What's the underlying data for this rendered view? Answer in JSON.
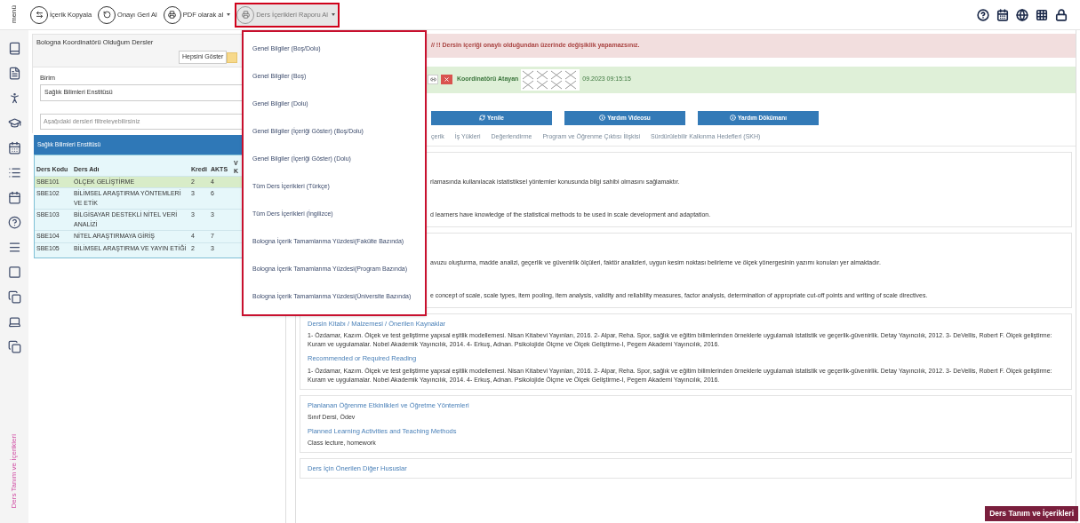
{
  "toolbar": {
    "menu_label": "menü",
    "buttons": [
      {
        "label": "İçerik Kopyala",
        "dropdown": false,
        "selected": false
      },
      {
        "label": "Onayı Geri Al",
        "dropdown": false,
        "selected": false
      },
      {
        "label": "PDF olarak al",
        "dropdown": true,
        "selected": false
      },
      {
        "label": "Ders İçerikleri Raporu Al",
        "dropdown": true,
        "selected": true
      }
    ]
  },
  "report_menu": {
    "items": [
      "Genel Bilgiler (Boş/Dolu)",
      "Genel Bilgiler (Boş)",
      "Genel Bilgiler (Dolu)",
      "Genel Bilgiler (İçeriği Göster) (Boş/Dolu)",
      "Genel Bilgiler (İçeriği Göster) (Dolu)",
      "Tüm Ders İçerikleri (Türkçe)",
      "Tüm Ders İçerikleri (İngilizce)",
      "Bologna İçerik Tamamlanma Yüzdesi(Fakülte Bazında)",
      "Bologna İçerik Tamamlanma Yüzdesi(Program Bazında)",
      "Bologna İçerik Tamamlanma Yüzdesi(Üniversite Bazında)"
    ]
  },
  "sidebar": {
    "vertical_label": "Ders Tanım ve İçerikleri"
  },
  "course_panel": {
    "title": "Bologna Koordinatörü Olduğum Dersler",
    "show_all_button": "Hepsini Göster",
    "unit_label": "Birim",
    "unit_value": "Sağlık Bilimleri Enstitüsü",
    "filter_placeholder": "Aşağıdaki dersleri filtreleyebilirsiniz",
    "group_title": "Sağlık Bilimleri Enstitüsü",
    "columns": [
      "Ders Kodu",
      "Ders Adı",
      "Kredi",
      "AKTS",
      "V K"
    ],
    "rows": [
      {
        "code": "SBE101",
        "name": "ÖLÇEK GELİŞTİRME",
        "credit": "2",
        "ects": "4",
        "selected": true
      },
      {
        "code": "SBE102",
        "name": "BİLİMSEL ARAŞTIRMA YÖNTEMLERİ VE ETİK",
        "credit": "3",
        "ects": "6",
        "selected": false
      },
      {
        "code": "SBE103",
        "name": "BİLGİSAYAR DESTEKLİ NİTEL VERİ ANALİZİ",
        "credit": "3",
        "ects": "3",
        "selected": false
      },
      {
        "code": "SBE104",
        "name": "NİTEL ARAŞTIRMAYA GİRİŞ",
        "credit": "4",
        "ects": "7",
        "selected": false
      },
      {
        "code": "SBE105",
        "name": "BİLİMSEL ARAŞTIRMA VE YAYIN ETİĞİ",
        "credit": "2",
        "ects": "3",
        "selected": false
      }
    ]
  },
  "content": {
    "alert": "// !! Dersin içeriği onaylı olduğundan üzerinde değişiklik yapamazsınız.",
    "assigner_label": "Koordinatörü Atayan",
    "assigned_date": "09.2023 09:15:15",
    "buttons": [
      "Yenile",
      "Yardım Videosu",
      "Yardım Dökümanı"
    ],
    "tabs": [
      {
        "label": "çerik",
        "selected": false
      },
      {
        "label": "İş Yükleri",
        "selected": false
      },
      {
        "label": "Değerlendirme",
        "selected": false
      },
      {
        "label": "Program ve Öğrenme Çıktısı İlişkisi",
        "selected": false
      },
      {
        "label": "Sürdürülebilir Kalkınma Hedefleri (SKH)",
        "selected": false
      }
    ],
    "partial_cards": [
      {
        "lines": [
          "rlamasında kullanılacak istatistiksel yöntemler konusunda bilgi sahibi olmasını sağlamaktır.",
          "d learners have knowledge of the statistical methods to be used in scale development and adaptation."
        ]
      },
      {
        "lines": [
          "avuzu oluşturma, madde analizi, geçerlik ve güvenirlik ölçüleri, faktör analizleri, uygun kesim noktası belirleme ve ölçek yönergesinin yazımı konuları yer almaktadır.",
          "e concept of scale, scale types, item pooling, item analysis, validity and reliability measures, factor analysis, determination of appropriate cut-off points and writing of scale directives."
        ]
      }
    ],
    "cards": [
      {
        "sections": [
          {
            "heading": "Dersin Kitabı / Malzemesi / Önerilen Kaynaklar",
            "body": "1- Özdamar, Kazım. Ölçek ve test geliştirme yapısal eşitlik modellemesi. Nisan Kitabevi Yayınları, 2016. 2- Alpar, Reha. Spor, sağlık ve eğitim bilimlerinden örneklerle uygulamalı istatistik ve geçerlik-güvenirlik. Detay Yayıncılık, 2012. 3- DeVellis, Robert F. Ölçek geliştirme: Kuram ve uygulamalar. Nobel Akademik Yayıncılık, 2014. 4- Erkuş, Adnan. Psikolojide Ölçme ve Ölçek Geliştirme-I, Pegem Akademi Yayıncılık, 2016."
          },
          {
            "heading": "Recommended or Required Reading",
            "body": "1- Özdamar, Kazım. Ölçek ve test geliştirme yapısal eşitlik modellemesi. Nisan Kitabevi Yayınları, 2016. 2- Alpar, Reha. Spor, sağlık ve eğitim bilimlerinden örneklerle uygulamalı istatistik ve geçerlik-güvenirlik. Detay Yayıncılık, 2012. 3- DeVellis, Robert F. Ölçek geliştirme: Kuram ve uygulamalar. Nobel Akademik Yayıncılık, 2014. 4- Erkuş, Adnan. Psikolojide Ölçme ve Ölçek Geliştirme-I, Pegem Akademi Yayıncılık, 2016."
          }
        ]
      },
      {
        "sections": [
          {
            "heading": "Planlanan Öğrenme Etkinlikleri ve Öğretme Yöntemleri",
            "body": "Sınıf Dersi, Ödev"
          },
          {
            "heading": "Planned Learning Activities and Teaching Methods",
            "body": "Class lecture, homework"
          }
        ]
      },
      {
        "sections": [
          {
            "heading": "Ders İçin Önerilen Diğer Hususlar"
          }
        ]
      }
    ],
    "badge": "Ders Tanım ve İçerikleri"
  }
}
